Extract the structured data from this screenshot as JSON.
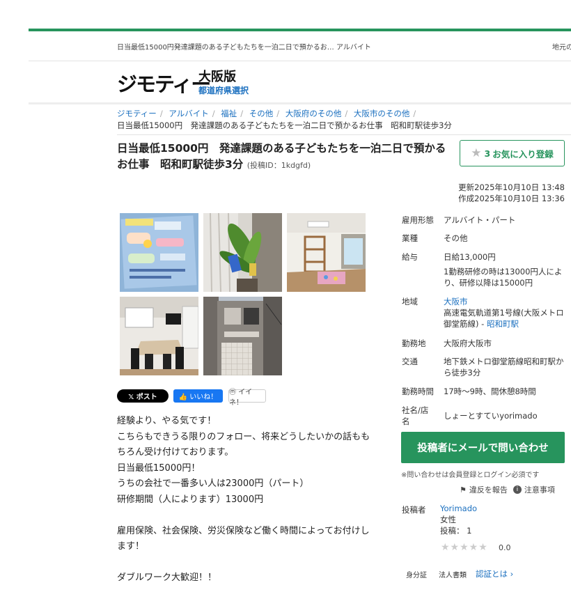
{
  "topbar": {
    "title": "日当最低15000円発達課題のある子どもたちを一泊二日で預かるお…  アルバイト",
    "right_text": "地元の"
  },
  "header": {
    "logo": "ジモティー",
    "region": "大阪版",
    "region_select": "都道府県選択"
  },
  "breadcrumb": {
    "items": [
      "ジモティー",
      "アルバイト",
      "福祉",
      "その他",
      "大阪府のその他",
      "大阪市のその他"
    ],
    "current": "日当最低15000円　発達課題のある子どもたちを一泊二日で預かるお仕事　昭和町駅徒歩3分"
  },
  "post": {
    "title": "日当最低15000円　発達課題のある子どもたちを一泊二日で預かるお仕事　昭和町駅徒歩3分",
    "post_id": "(投稿ID：1kdgfd)",
    "fav_count": "3",
    "fav_label": "お気に入り登録",
    "updated": "更新2025年10月10日 13:48",
    "created": "作成2025年10月10日 13:36"
  },
  "share": {
    "x": "𝕏 ポスト",
    "facebook": "👍 いいね！",
    "mixi": "ⓜ イイネ！"
  },
  "description": [
    "経験より、やる気です！",
    "こちらもできうる限りのフォロー、将来どうしたいかの話もも",
    "ちろん受け付けております。",
    "日当最低15000円！",
    "うちの会社で一番多い人は23000円（パート）",
    "研修期間（人によります）13000円",
    "",
    "雇用保険、社会保険、労災保険など働く時間によってお付けし",
    "ます！",
    "",
    "ダブルワーク大歓迎！！"
  ],
  "specs": {
    "employment_k": "雇用形態",
    "employment_v": "アルバイト・パート",
    "industry_k": "業種",
    "industry_v": "その他",
    "salary_k": "給与",
    "salary_v1": "日給13,000円",
    "salary_v2": "1勤務研修の時は13000円人により、研修以降は15000円",
    "area_k": "地域",
    "area_city": "大阪市",
    "area_line": "高速電気軌道第1号線(大阪メトロ御堂筋線) -",
    "area_station": "昭和町駅",
    "workplace_k": "勤務地",
    "workplace_v": "大阪府大阪市",
    "transport_k": "交通",
    "transport_v": "地下鉄メトロ御堂筋線昭和町駅から徒歩3分",
    "hours_k": "勤務時間",
    "hours_v": "17時〜9時、間休憩8時間",
    "company_k": "社名/店名",
    "company_v": "しょーとすていyorimado"
  },
  "contact": {
    "button": "投稿者にメールで問い合わせ",
    "note": "※問い合わせは会員登録とログイン必須です",
    "report": "違反を報告",
    "caution": "注意事項"
  },
  "poster": {
    "label": "投稿者",
    "name": "Yorimado",
    "gender": "女性",
    "posts": "投稿：  1",
    "stars": "★★★★★",
    "rating": "0.0",
    "id_verify": "身分証",
    "corp_docs": "法人書類",
    "cert_link": "認証とは ›"
  }
}
